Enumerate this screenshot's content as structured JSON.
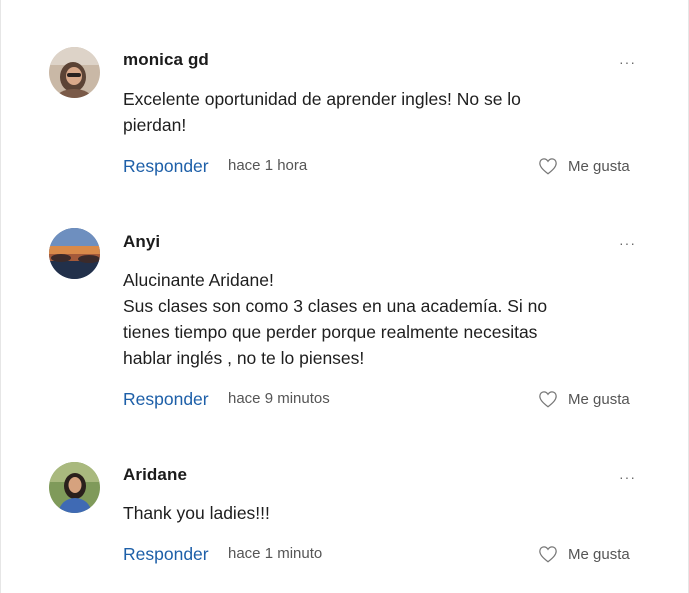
{
  "comments": [
    {
      "author": "monica gd",
      "more": "···",
      "lines": [
        "Excelente oportunidad de aprender ingles! No se lo",
        "pierdan!"
      ],
      "reply_label": "Responder",
      "time": "hace 1 hora",
      "like_label": "Me gusta"
    },
    {
      "author": "Anyi",
      "more": "···",
      "lines": [
        "Alucinante Aridane!",
        "Sus clases son como 3 clases en una academía. Si no",
        "tienes tiempo que perder porque realmente necesitas",
        "hablar inglés , no te lo pienses!"
      ],
      "reply_label": "Responder",
      "time": "hace 9 minutos",
      "like_label": "Me gusta"
    },
    {
      "author": "Aridane",
      "more": "···",
      "lines": [
        "Thank you ladies!!!"
      ],
      "reply_label": "Responder",
      "time": "hace 1 minuto",
      "like_label": "Me gusta"
    }
  ],
  "colors": {
    "link": "#1d5fa8",
    "text": "#1e1e1e",
    "muted": "#555555"
  },
  "icons": {
    "more": "more-options-icon",
    "like": "heart-outline-icon"
  }
}
